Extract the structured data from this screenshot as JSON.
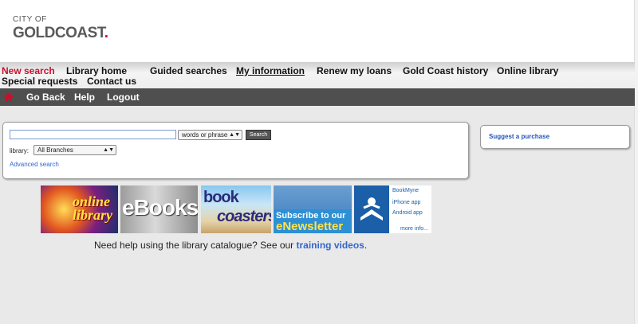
{
  "logo": {
    "line1": "CITY OF",
    "line2": "GOLDCOAST",
    "dot": "."
  },
  "nav": {
    "items": [
      {
        "label": "New search"
      },
      {
        "label": "Library home"
      },
      {
        "label": "Guided searches"
      },
      {
        "label": "My information"
      },
      {
        "label": "Renew my loans"
      },
      {
        "label": "Gold Coast history"
      },
      {
        "label": "Online library"
      },
      {
        "label": "Special requests"
      },
      {
        "label": "Contact us"
      }
    ]
  },
  "toolbar": {
    "back": "Go Back",
    "help": "Help",
    "logout": "Logout"
  },
  "search": {
    "query": "",
    "mode": "words or phrase",
    "button": "Search",
    "library_label": "library:",
    "library": "All Branches",
    "advanced": "Advanced search"
  },
  "side": {
    "suggest": "Suggest a purchase"
  },
  "banners": {
    "online": "online library",
    "ebooks": "eBooks",
    "book1": "book",
    "book2": "coasters",
    "news1": "Subscribe to our",
    "news2": "eNewsletter",
    "bookmyne": "BookMyne",
    "iphone": "iPhone app",
    "android": "Android app",
    "more": "more info..."
  },
  "help": {
    "text": "Need help using the library catalogue? See our ",
    "link": "training videos",
    "end": "."
  },
  "colors": {
    "accent": "#c8102e",
    "link": "#3366cc",
    "toolbar": "#4f4f4f"
  }
}
